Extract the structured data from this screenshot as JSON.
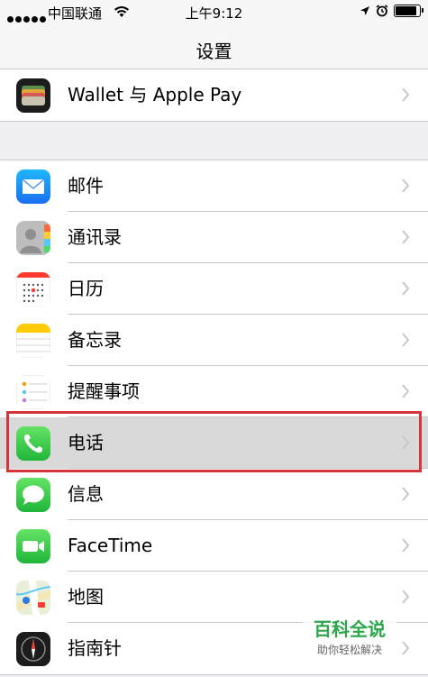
{
  "status_bar": {
    "carrier": "中国联通",
    "time": "上午9:12",
    "battery_level": 0.9
  },
  "nav": {
    "title": "设置"
  },
  "top_group": [
    {
      "label": "Wallet 与 Apple Pay",
      "icon": "wallet-icon"
    }
  ],
  "apps_group": [
    {
      "label": "邮件",
      "icon": "mail-icon"
    },
    {
      "label": "通讯录",
      "icon": "contacts-icon"
    },
    {
      "label": "日历",
      "icon": "calendar-icon"
    },
    {
      "label": "备忘录",
      "icon": "notes-icon"
    },
    {
      "label": "提醒事项",
      "icon": "reminders-icon"
    },
    {
      "label": "电话",
      "icon": "phone-icon",
      "selected": true
    },
    {
      "label": "信息",
      "icon": "messages-icon"
    },
    {
      "label": "FaceTime",
      "icon": "facetime-icon"
    },
    {
      "label": "地图",
      "icon": "maps-icon"
    },
    {
      "label": "指南针",
      "icon": "compass-icon"
    }
  ],
  "watermark": {
    "title": "百科全说",
    "subtitle": "助你轻松解决"
  },
  "colors": {
    "highlight_border": "#d6343b",
    "separator": "#c8c7cc",
    "background": "#efeff4"
  }
}
